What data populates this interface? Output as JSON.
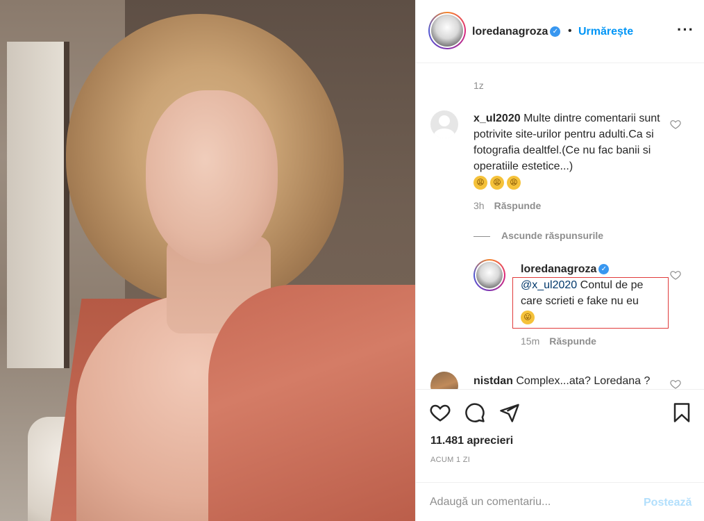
{
  "post": {
    "author": "loredanagroza",
    "follow_label": "Urmărește",
    "dot": "•",
    "more": "···",
    "caption_time": "1z"
  },
  "comments": [
    {
      "user": "x_ul2020",
      "text": "Multe dintre comentarii sunt potrivite site-urilor pentru adulti.Ca si fotografia dealtfel.(Ce nu fac banii si operatiile estetice...)",
      "emojis": [
        "😩",
        "😩",
        "😩"
      ],
      "time": "3h",
      "reply_label": "Răspunde"
    }
  ],
  "hide_replies_label": "Ascunde răspunsurile",
  "reply": {
    "user": "loredanagroza",
    "mention": "@x_ul2020",
    "text": " Contul de pe care scrieti e fake nu eu",
    "emoji": "😛",
    "time": "15m",
    "reply_label": "Răspunde"
  },
  "partial_comment": {
    "user": "nistdan",
    "text": "Complex...ata? Loredana ?"
  },
  "actions": {
    "likes": "11.481 aprecieri",
    "ago": "ACUM 1 ZI"
  },
  "add_comment": {
    "placeholder": "Adaugă un comentariu...",
    "post_label": "Postează"
  },
  "icons": {
    "heart": "heart-icon",
    "comment": "comment-icon",
    "share": "share-icon",
    "save": "bookmark-icon",
    "more": "more-options-icon",
    "verified": "verified-badge-icon"
  },
  "colors": {
    "link_blue": "#0095f6",
    "post_disabled": "#b2dffc",
    "highlight_box": "#e03a3a",
    "muted": "#8e8e8e"
  }
}
